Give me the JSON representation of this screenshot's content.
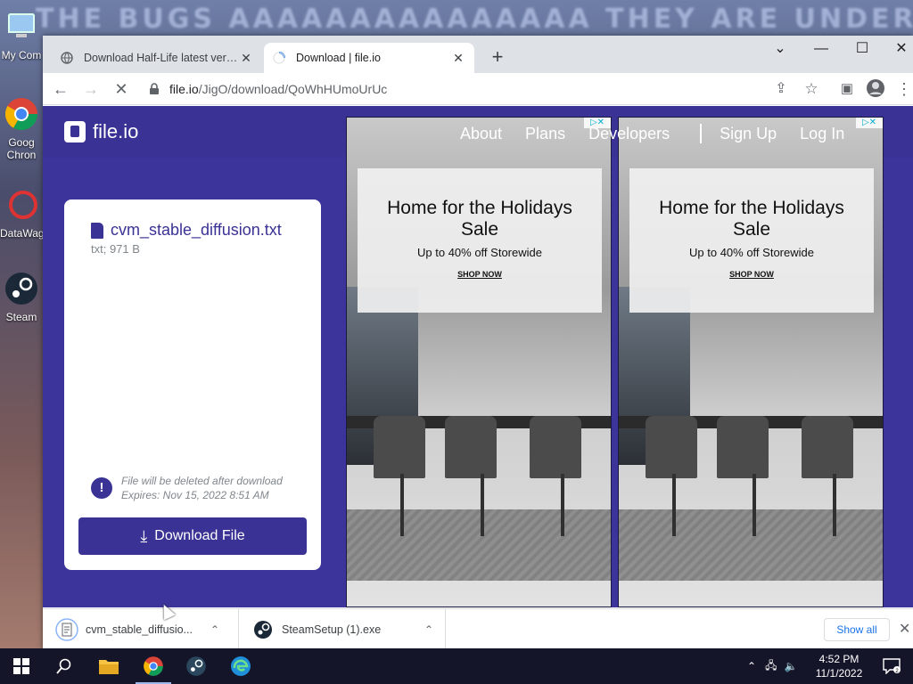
{
  "desktop": {
    "banner": "THE BUGS AAAAAAAAAAAAAAA THEY ARE UNDER MY SKIN",
    "icons": [
      {
        "label": "My Com",
        "icon": "computer-icon"
      },
      {
        "label": "Goog Chron",
        "icon": "chrome-icon"
      },
      {
        "label": "DataWag",
        "icon": "datawag-icon"
      },
      {
        "label": "Steam",
        "icon": "steam-icon"
      }
    ]
  },
  "browser": {
    "tabs": [
      {
        "title": "Download Half-Life latest version",
        "icon": "globe-icon",
        "active": false
      },
      {
        "title": "Download | file.io",
        "icon": "loading-spinner-icon",
        "active": true
      }
    ],
    "new_tab": "+",
    "url_host": "file.io",
    "url_path": "/JigO/download/QoWhHUmoUrUc"
  },
  "page": {
    "logo": "file.io",
    "nav": [
      "About",
      "Plans",
      "Developers",
      "Sign Up",
      "Log In"
    ],
    "file": {
      "name": "cvm_stable_diffusion.txt",
      "meta": "txt; 971 B"
    },
    "warning": {
      "line1": "File will be deleted after download",
      "line2": "Expires: Nov 15, 2022 8:51 AM"
    },
    "download_button": "Download File",
    "ads": [
      {
        "headline": "Home for the Holidays Sale",
        "sub": "Up to 40% off Storewide",
        "cta": "SHOP NOW"
      },
      {
        "headline": "Home for the Holidays Sale",
        "sub": "Up to 40% off Storewide",
        "cta": "SHOP NOW"
      }
    ]
  },
  "shelf": {
    "items": [
      {
        "name": "cvm_stable_diffusio...",
        "icon": "text-file-icon"
      },
      {
        "name": "SteamSetup (1).exe",
        "icon": "steam-icon"
      }
    ],
    "show_all": "Show all"
  },
  "taskbar": {
    "time": "4:52 PM",
    "date": "11/1/2022"
  },
  "colors": {
    "brand": "#3a3294",
    "page_bg": "#3c349a"
  }
}
